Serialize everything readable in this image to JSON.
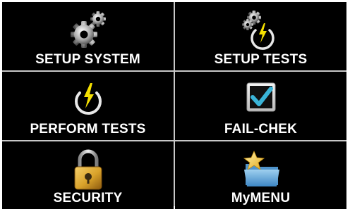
{
  "menu": {
    "tiles": [
      {
        "label": "SETUP SYSTEM",
        "icon": "gears-icon"
      },
      {
        "label": "SETUP TESTS",
        "icon": "gear-power-icon"
      },
      {
        "label": "PERFORM TESTS",
        "icon": "power-bolt-icon"
      },
      {
        "label": "FAIL-CHEK",
        "icon": "checkbox-checked-icon"
      },
      {
        "label": "SECURITY",
        "icon": "padlock-icon"
      },
      {
        "label": "MyMENU",
        "icon": "star-folder-icon"
      }
    ]
  },
  "colors": {
    "tile_background": "#000000",
    "divider": "#c8c8c8",
    "label_text": "#ffffff",
    "bolt_yellow": "#f5e000",
    "check_cyan": "#3ab4d8",
    "lock_gold": "#d9a22a",
    "folder_blue": "#5aa6d8",
    "star_gold": "#f2c230"
  }
}
